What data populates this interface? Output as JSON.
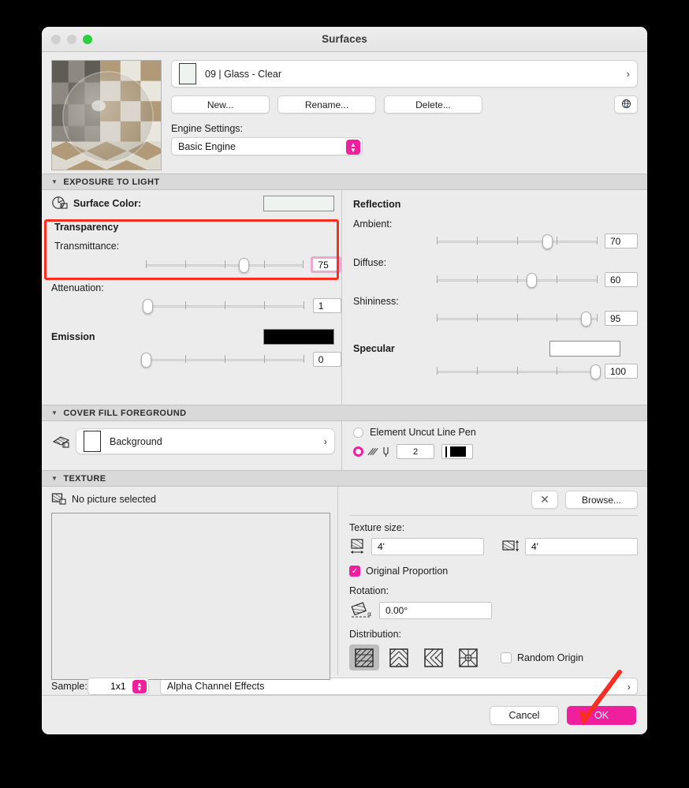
{
  "window": {
    "title": "Surfaces",
    "traffic_lights": [
      "close",
      "minimize",
      "zoom"
    ]
  },
  "surface": {
    "name": "09 | Glass - Clear",
    "swatch_color": "#eef3f0",
    "buttons": {
      "new": "New...",
      "rename": "Rename...",
      "delete": "Delete..."
    },
    "globe_icon": "globe-icon",
    "engine_label": "Engine Settings:",
    "engine_value": "Basic Engine"
  },
  "exposure": {
    "header": "EXPOSURE TO LIGHT",
    "surface_color_label": "Surface Color:",
    "surface_color_value": "#eef3f0",
    "transparency_group": "Transparency",
    "transmittance_label": "Transmittance:",
    "transmittance_value": "75",
    "attenuation_label": "Attenuation:",
    "attenuation_value": "1",
    "emission_label": "Emission",
    "emission_color": "#000000",
    "emission_value": "0",
    "reflection_group": "Reflection",
    "ambient_label": "Ambient:",
    "ambient_value": "70",
    "diffuse_label": "Diffuse:",
    "diffuse_value": "60",
    "shininess_label": "Shininess:",
    "shininess_value": "95",
    "specular_label": "Specular",
    "specular_color": "#ffffff",
    "specular_value": "100"
  },
  "cover_fill": {
    "header": "COVER FILL FOREGROUND",
    "fill_name": "Background",
    "uncut_pen_label": "Element Uncut Line Pen",
    "pen_number": "2",
    "pen_color": "#000000"
  },
  "texture": {
    "header": "TEXTURE",
    "picture_status": "No picture selected",
    "clear_label": "✕",
    "browse_label": "Browse...",
    "size_label": "Texture size:",
    "width_value": "4'",
    "height_value": "4'",
    "original_proportion_label": "Original Proportion",
    "original_proportion_checked": true,
    "rotation_label": "Rotation:",
    "rotation_value": "0.00°",
    "distribution_label": "Distribution:",
    "distribution_options": [
      "normal",
      "mirrored",
      "rotated",
      "random"
    ],
    "distribution_selected": 0,
    "random_origin_label": "Random Origin",
    "random_origin_checked": false,
    "sample_label": "Sample:",
    "sample_value": "1x1",
    "alpha_label": "Alpha Channel Effects"
  },
  "footer": {
    "cancel": "Cancel",
    "ok": "OK"
  },
  "annotations": {
    "highlight_color": "#fa2e20",
    "highlight_target": "Transparency",
    "arrow_target": "OK"
  },
  "slider_positions": {
    "transmittance_pct": 75,
    "attenuation_pct": 1,
    "ambient_pct": 70,
    "diffuse_pct": 60,
    "shininess_pct": 95,
    "emission_pct": 0,
    "specular_pct": 100
  }
}
